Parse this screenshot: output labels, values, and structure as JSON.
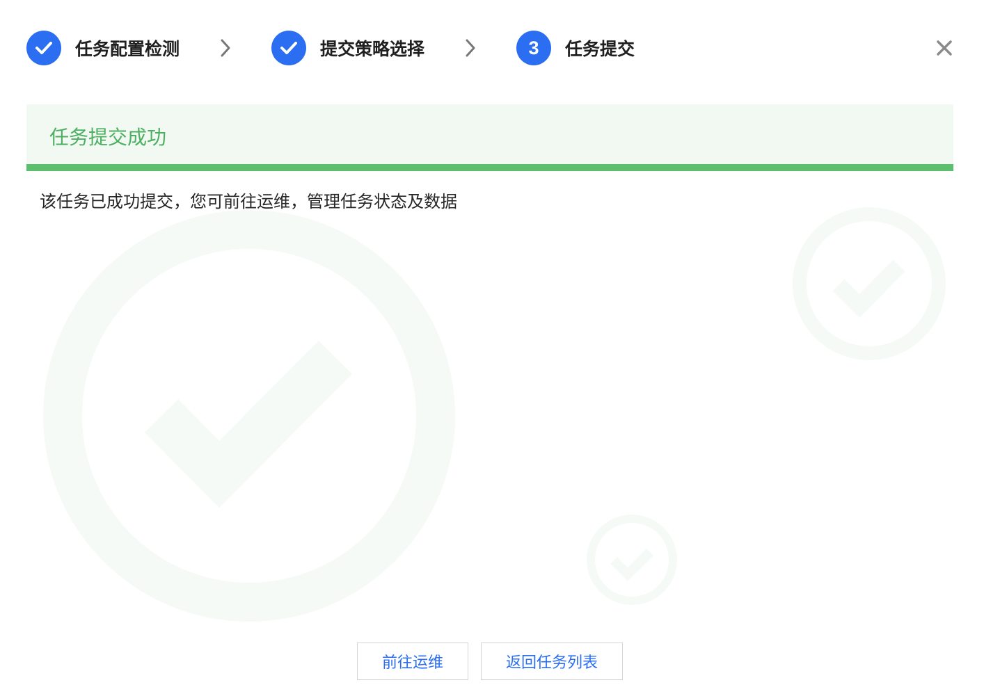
{
  "stepper": {
    "steps": [
      {
        "label": "任务配置检测",
        "status": "done"
      },
      {
        "label": "提交策略选择",
        "status": "done"
      },
      {
        "label": "任务提交",
        "status": "current",
        "number": "3"
      }
    ]
  },
  "banner": {
    "title": "任务提交成功"
  },
  "description": "该任务已成功提交，您可前往运维，管理任务状态及数据",
  "actions": {
    "go_ops_label": "前往运维",
    "back_list_label": "返回任务列表"
  },
  "colors": {
    "primary": "#2b6ef2",
    "success": "#5cbf6d",
    "success_bg": "#f1f9f2",
    "success_text": "#4caf62"
  },
  "icons": {
    "close": "close-icon",
    "step_done": "check-icon",
    "separator": "chevron-right-icon",
    "decoration": "check-circle-icon"
  }
}
